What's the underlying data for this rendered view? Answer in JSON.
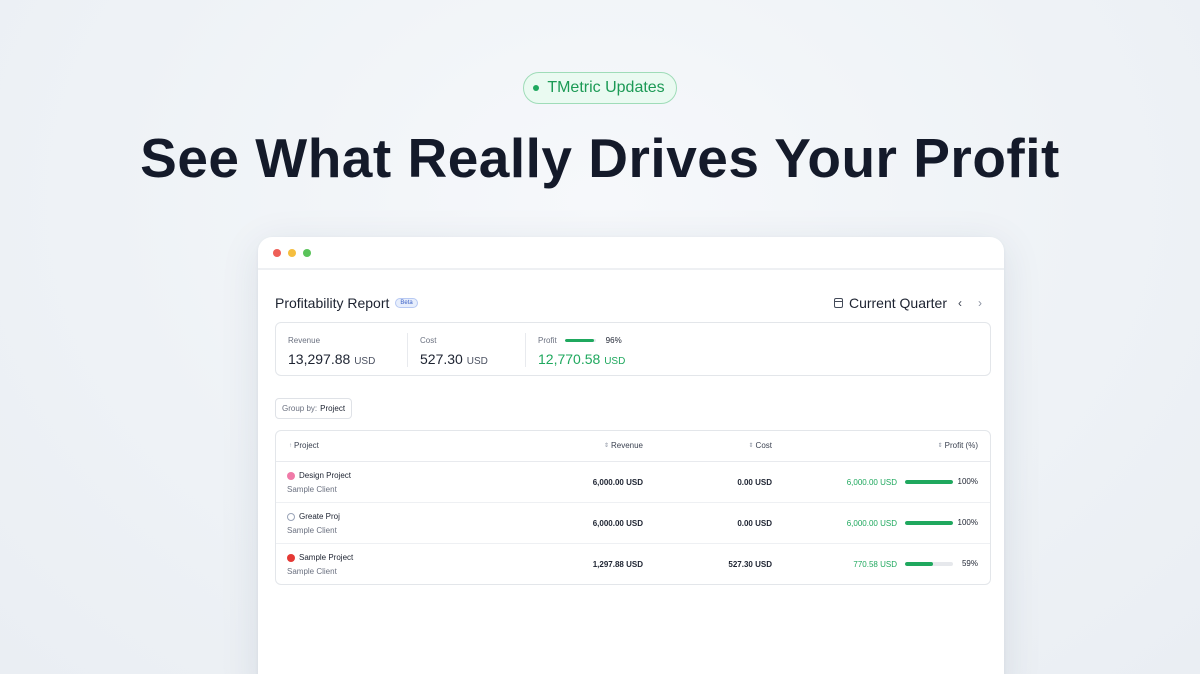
{
  "hero": {
    "badge": "TMetric Updates",
    "headline": "See What Really Drives Your Profit"
  },
  "report": {
    "title": "Profitability Report",
    "beta": "Beta",
    "period": "Current Quarter",
    "prev": "‹",
    "next": "›"
  },
  "summary": {
    "revenue": {
      "label": "Revenue",
      "value": "13,297.88",
      "unit": "USD"
    },
    "cost": {
      "label": "Cost",
      "value": "527.30",
      "unit": "USD"
    },
    "profit": {
      "label": "Profit",
      "value": "12,770.58",
      "unit": "USD",
      "percent": "96%",
      "percent_value": 96
    }
  },
  "group_by": {
    "label": "Group by:",
    "value": "Project"
  },
  "table": {
    "columns": {
      "project": "Project",
      "revenue": "Revenue",
      "cost": "Cost",
      "profit": "Profit (%)"
    },
    "rows": [
      {
        "name": "Design Project",
        "client": "Sample Client",
        "color": "#f07aa8",
        "revenue": "6,000.00 USD",
        "cost": "0.00 USD",
        "profit": "6,000.00 USD",
        "percent": "100%",
        "percent_value": 100
      },
      {
        "name": "Greate Proj",
        "client": "Sample Client",
        "color": "#9aa4b8",
        "revenue": "6,000.00 USD",
        "cost": "0.00 USD",
        "profit": "6,000.00 USD",
        "percent": "100%",
        "percent_value": 100
      },
      {
        "name": "Sample Project",
        "client": "Sample Client",
        "color": "#e53935",
        "revenue": "1,297.88 USD",
        "cost": "527.30 USD",
        "profit": "770.58 USD",
        "percent": "59%",
        "percent_value": 59
      }
    ]
  },
  "colors": {
    "accent_green": "#1fa85e",
    "badge_border": "#9fdcb8"
  }
}
